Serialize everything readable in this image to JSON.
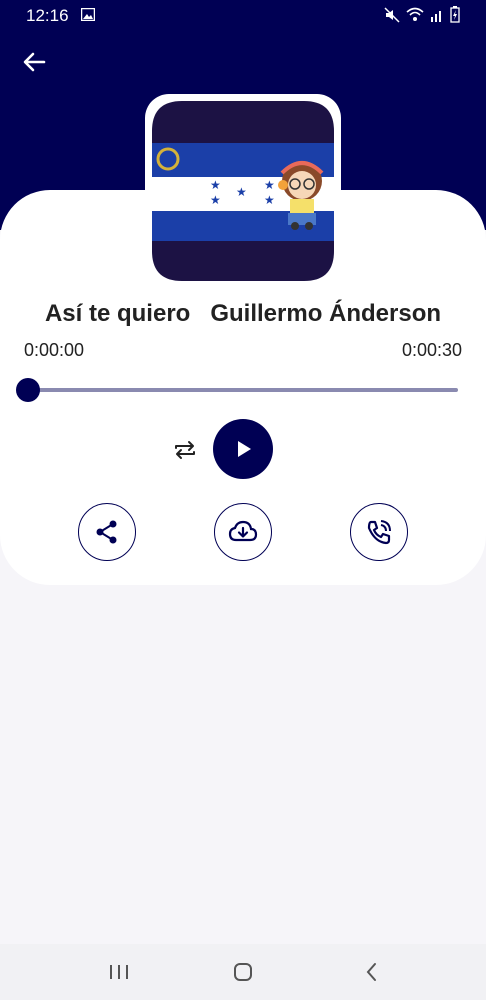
{
  "status_bar": {
    "time": "12:16"
  },
  "track": {
    "title": "Así te quiero",
    "artist": "Guillermo Ánderson"
  },
  "player": {
    "current_time": "0:00:00",
    "duration": "0:00:30",
    "progress": 0.0
  },
  "colors": {
    "primary": "#000054",
    "track": "#8a8ab0",
    "background": "#f6f5f9"
  },
  "icons": {
    "back": "arrow-left-icon",
    "repeat": "repeat-icon",
    "play": "play-icon",
    "share": "share-icon",
    "download": "cloud-download-icon",
    "ringtone": "phone-ring-icon"
  }
}
